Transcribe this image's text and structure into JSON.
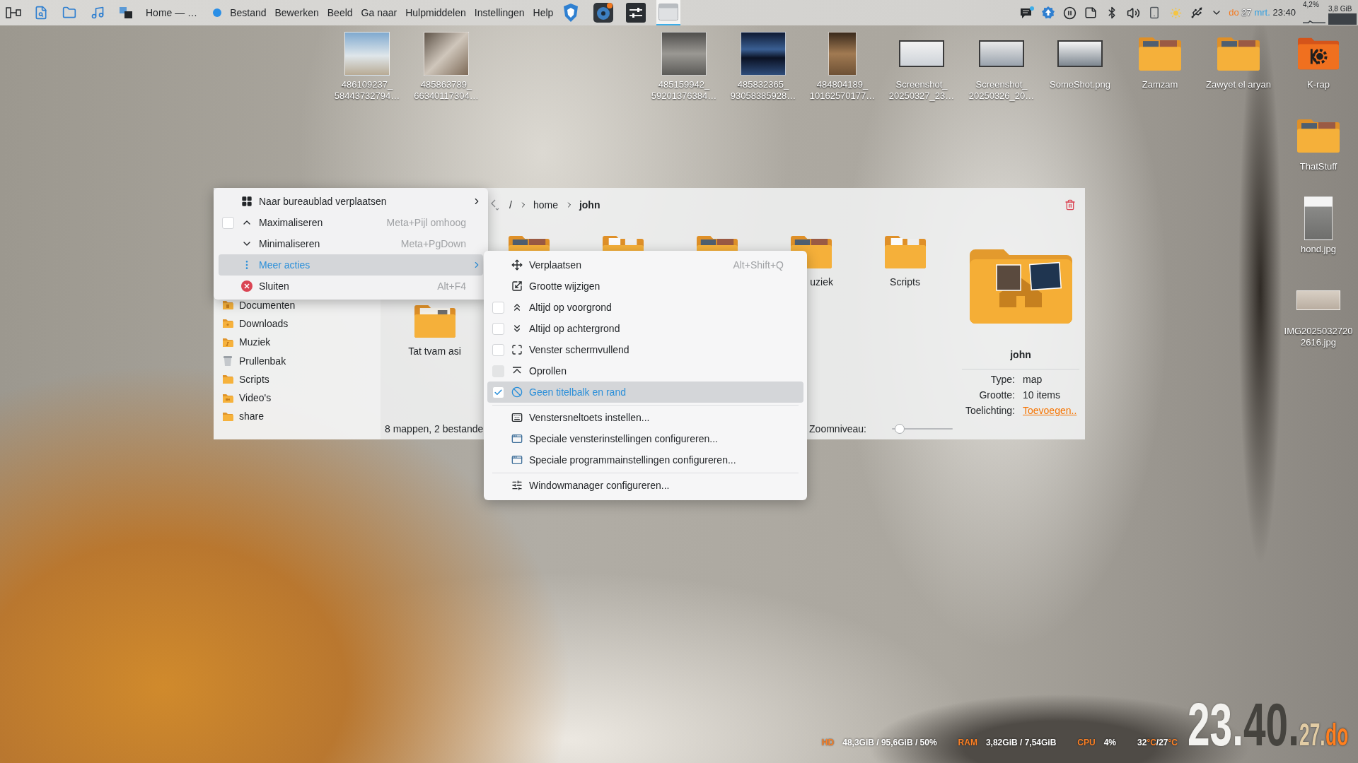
{
  "top_panel": {
    "window_title": "Home — …",
    "app_menu": [
      "Bestand",
      "Bewerken",
      "Beeld",
      "Ga naar",
      "Hulpmiddelen",
      "Instellingen",
      "Help"
    ],
    "tasks": [
      {
        "kind": "browser",
        "selected": false
      },
      {
        "kind": "music",
        "selected": false
      },
      {
        "kind": "mixer",
        "selected": false
      },
      {
        "kind": "window",
        "selected": true
      }
    ],
    "clock": [
      "do",
      "27",
      "mrt.",
      "23:40"
    ],
    "monitor": {
      "cpu": "4,2%",
      "memory": "3,8 GiB"
    }
  },
  "desktop_icons": [
    {
      "label": "486109237_\n58443732794…",
      "kind": "photo"
    },
    {
      "label": "485863789_\n66340117304…",
      "kind": "photo"
    },
    {
      "label": "485159942_\n59201376384…",
      "kind": "photo"
    },
    {
      "label": "485832365_\n93058385928…",
      "kind": "photo"
    },
    {
      "label": "484804189_\n10162570177…",
      "kind": "portrait"
    },
    {
      "label": "Screenshot_\n20250327_23…",
      "kind": "screenshot"
    },
    {
      "label": "Screenshot_\n20250326_20…",
      "kind": "screenshot"
    },
    {
      "label": "SomeShot.png",
      "kind": "screenshot"
    },
    {
      "label": "Zamzam",
      "kind": "folder"
    },
    {
      "label": "Zawyet el aryan",
      "kind": "folder"
    },
    {
      "label": "K-rap",
      "kind": "app"
    },
    {
      "label": "ThatStuff",
      "kind": "folder"
    },
    {
      "label": "hond.jpg",
      "kind": "portrait"
    },
    {
      "label": "IMG2025032720\n2616.jpg",
      "kind": "panorama"
    }
  ],
  "file_manager": {
    "breadcrumb": [
      {
        "label": "/",
        "selected": false
      },
      {
        "label": "home",
        "selected": false
      },
      {
        "label": "john",
        "selected": true
      }
    ],
    "places": [
      {
        "label": "Documenten",
        "kind": "documents"
      },
      {
        "label": "Downloads",
        "kind": "downloads"
      },
      {
        "label": "Muziek",
        "kind": "music"
      },
      {
        "label": "Prullenbak",
        "kind": "trash"
      },
      {
        "label": "Scripts",
        "kind": "folder"
      },
      {
        "label": "Video's",
        "kind": "videos"
      },
      {
        "label": "share",
        "kind": "folder"
      }
    ],
    "items": [
      {
        "kind": "photos"
      },
      {
        "kind": "documents"
      },
      {
        "kind": "photos"
      },
      {
        "kind": "photos",
        "label": "uziek",
        "partial": true
      },
      {
        "kind": "documents",
        "label": "Scripts",
        "partial": false
      },
      {
        "kind": "fonts",
        "label": "Tat tvam asi",
        "partial": false
      }
    ],
    "status": "8 mappen, 2 bestande",
    "zoom": {
      "label": "Zoomniveau:",
      "level": 0.05
    },
    "info": {
      "name": "john",
      "fields": [
        {
          "label": "Type:",
          "value": "map",
          "kind": "text"
        },
        {
          "label": "Grootte:",
          "value": "10 items",
          "kind": "text"
        },
        {
          "label": "Toelichting:",
          "value": "Toevoegen..",
          "kind": "link"
        }
      ]
    }
  },
  "window_menu": [
    {
      "label": "Naar bureaublad verplaatsen",
      "kind": "action",
      "submenu": true,
      "selected": false
    },
    {
      "label": "Maximaliseren",
      "kind": "checkbox",
      "checked": false,
      "shortcut": "Meta+Pijl omhoog",
      "submenu": false,
      "selected": false
    },
    {
      "label": "Minimaliseren",
      "kind": "action",
      "shortcut": "Meta+PgDown",
      "submenu": false,
      "selected": false
    },
    {
      "label": "Meer acties",
      "kind": "action",
      "submenu": true,
      "selected": true
    },
    {
      "label": "Sluiten",
      "kind": "action",
      "shortcut": "Alt+F4",
      "submenu": false,
      "selected": false
    }
  ],
  "more_actions_menu": [
    {
      "label": "Verplaatsen",
      "kind": "action",
      "shortcut": "Alt+Shift+Q",
      "selected": false
    },
    {
      "label": "Grootte wijzigen",
      "kind": "action",
      "selected": false
    },
    {
      "label": "Altijd op voorgrond",
      "kind": "checkbox",
      "checked": false,
      "disabled": false,
      "selected": false
    },
    {
      "label": "Altijd op achtergrond",
      "kind": "checkbox",
      "checked": false,
      "disabled": false,
      "selected": false
    },
    {
      "label": "Venster schermvullend",
      "kind": "checkbox",
      "checked": false,
      "disabled": false,
      "selected": false
    },
    {
      "label": "Oprollen",
      "kind": "checkbox",
      "checked": false,
      "disabled": true,
      "selected": false
    },
    {
      "label": "Geen titelbalk en rand",
      "kind": "checkbox",
      "checked": true,
      "disabled": false,
      "selected": true
    },
    {
      "kind": "separator"
    },
    {
      "label": "Venstersneltoets instellen...",
      "kind": "action",
      "selected": false
    },
    {
      "label": "Speciale vensterinstellingen configureren...",
      "kind": "action",
      "selected": false
    },
    {
      "label": "Speciale programmainstellingen configureren...",
      "kind": "action",
      "selected": false
    },
    {
      "kind": "separator"
    },
    {
      "label": "Windowmanager configureren...",
      "kind": "action",
      "selected": false
    }
  ],
  "system_stats": {
    "items": [
      {
        "label": "HD",
        "value": "48,3GiB / 95,6GiB / 50%"
      },
      {
        "label": "RAM",
        "value": "3,82GiB / 7,54GiB"
      },
      {
        "label": "CPU",
        "value": "4%"
      }
    ],
    "temperature": [
      "32",
      "°C",
      "/27",
      "°C"
    ]
  },
  "big_clock": [
    "23.",
    "40.",
    "27.",
    "do"
  ]
}
